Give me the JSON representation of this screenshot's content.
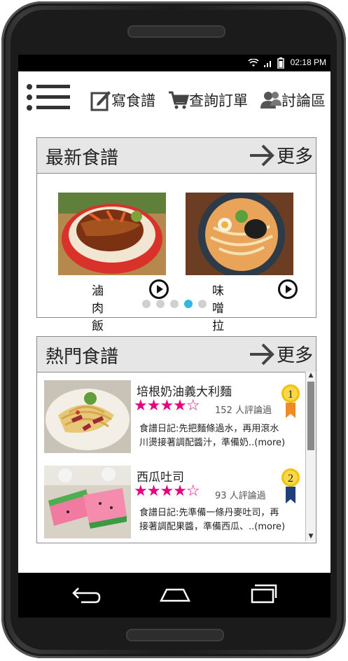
{
  "status": {
    "time": "02:18 PM"
  },
  "nav": {
    "write": "寫食譜",
    "orders": "查詢訂單",
    "forum": "討論區"
  },
  "latest": {
    "title": "最新食譜",
    "more": "更多",
    "items": [
      {
        "name": "滷肉飯"
      },
      {
        "name": "味噌拉麵"
      }
    ],
    "pager_active": 3,
    "pager_count": 5
  },
  "popular": {
    "title": "熱門食譜",
    "more": "更多",
    "items": [
      {
        "title": "培根奶油義大利麵",
        "rating": 4.5,
        "reviews": "152 人評論過",
        "diary_line1": "食譜日記:先把麵條過水，再用滾水",
        "diary_line2": "川燙接著調配醬汁，準備奶..(more)",
        "rank": "1",
        "rank_color": "#f08a24"
      },
      {
        "title": "西瓜吐司",
        "rating": 4.5,
        "reviews": "93 人評論過",
        "diary_line1": "食譜日記:先準備一條丹麥吐司，再",
        "diary_line2": "接著調配果醬，準備西瓜、..(more)",
        "rank": "2",
        "rank_color": "#1f3f7a"
      }
    ]
  },
  "colors": {
    "accent": "#33b5e5",
    "stars": "#e6007e",
    "header_bg": "#e6e6e6"
  }
}
